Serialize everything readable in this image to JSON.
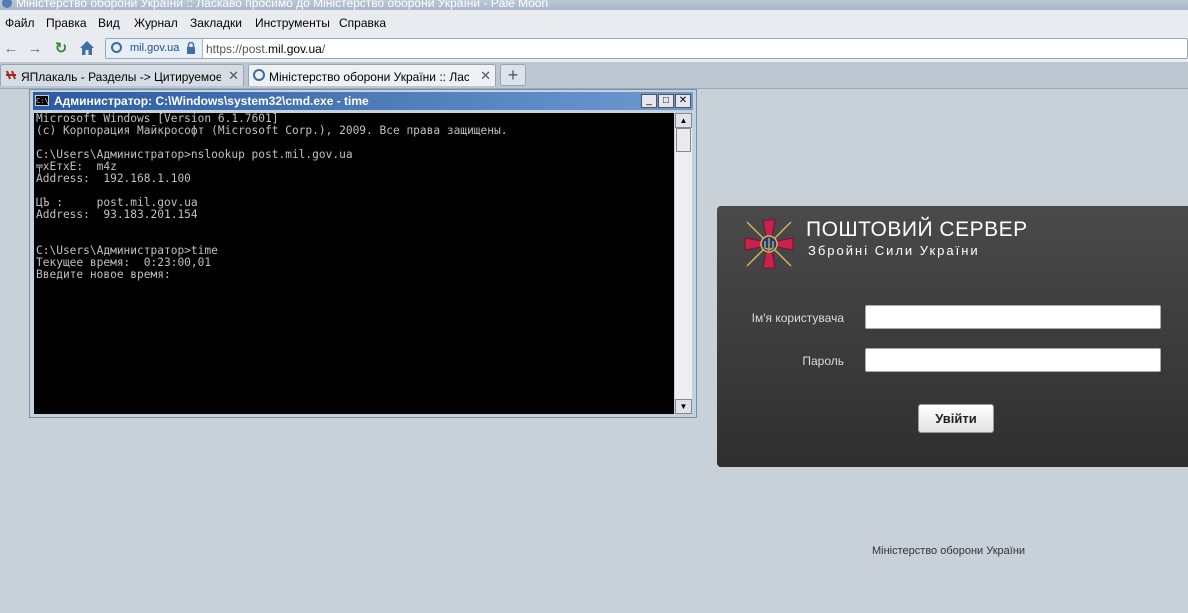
{
  "window": {
    "title": "Міністерство оборони України :: Ласкаво просимо до Міністерство оборони України - Pale Moon"
  },
  "menu": [
    "Файл",
    "Правка",
    "Вид",
    "Журнал",
    "Закладки",
    "Инструменты",
    "Справка"
  ],
  "address_bar": {
    "identity": "mil.gov.ua",
    "url_prefix": "https://post.",
    "url_domain": "mil.gov.ua",
    "url_suffix": "/"
  },
  "tabs": [
    {
      "label": "ЯПлакаль - Разделы -> Цитируемое с..."
    },
    {
      "label": "Міністерство оборони України :: Ласка..."
    }
  ],
  "icons": {
    "back": "back-arrow-icon",
    "forward": "forward-arrow-icon",
    "reload": "reload-icon",
    "home": "home-icon",
    "close": "close-icon",
    "new_tab": "plus-icon"
  },
  "cmd": {
    "title": "Администратор: C:\\Windows\\system32\\cmd.exe - time",
    "text": "Microsoft Windows [Version 6.1.7601]\n(c) Корпорация Майкрософт (Microsoft Corp.), 2009. Все права защищены.\n\nC:\\Users\\Администратор>nslookup post.mil.gov.ua\n╤xEтxE:  m4z\nAddress:  192.168.1.100\n\nЦЪ :     post.mil.gov.ua\nAddress:  93.183.201.154\n\n\nC:\\Users\\Администратор>time\nТекущее время:  0:23:00,01\nВведите новое время:"
  },
  "login": {
    "title": "ПОШТОВИЙ СЕРВЕР",
    "subtitle": "Збройні Сили України",
    "username_label": "Ім'я користувача",
    "password_label": "Пароль",
    "username_value": "",
    "password_value": "",
    "submit": "Увійти"
  },
  "footer": "Міністерство оборони України",
  "colors": {
    "page_bg": "#c8d0d8",
    "panel_bg": "#3a3a3a",
    "emblem": "#c8224e",
    "console_bg": "#000000",
    "console_fg": "#c0c0c0"
  }
}
